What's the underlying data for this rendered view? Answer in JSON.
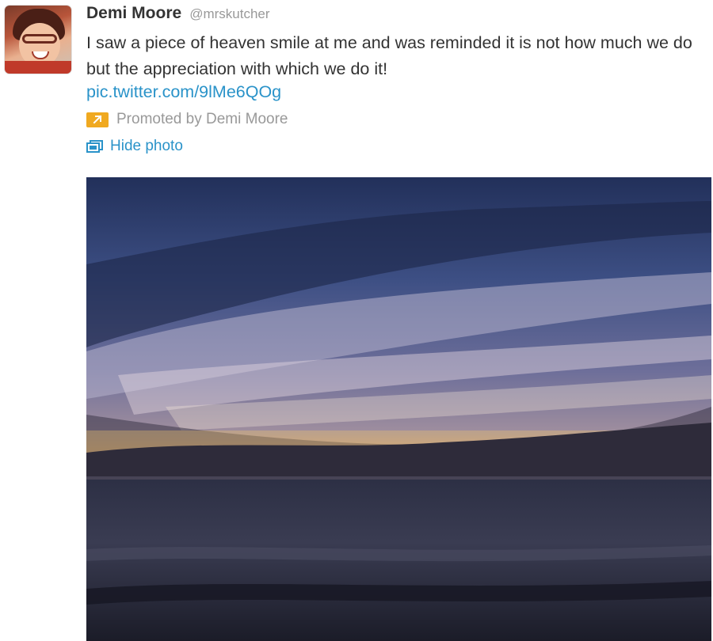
{
  "tweet": {
    "author_name": "Demi Moore",
    "author_handle": "@mrskutcher",
    "text": "I saw a piece of heaven smile at me and was reminded it is not how much we do but the appreciation with which we do it!",
    "link_text": "pic.twitter.com/9lMe6QOg",
    "promoted_label": "Promoted by Demi Moore",
    "hide_photo_label": "Hide photo"
  },
  "icons": {
    "promoted": "promoted-arrow-icon",
    "hide_photo": "photo-icon"
  },
  "colors": {
    "link": "#2a93c9",
    "promoted_badge": "#f0a920",
    "secondary_text": "#999999",
    "primary_text": "#333333"
  }
}
